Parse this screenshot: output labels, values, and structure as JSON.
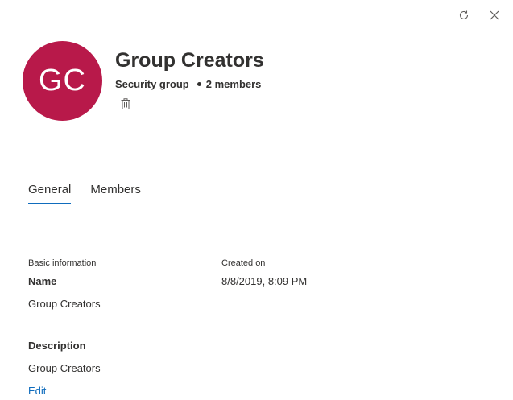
{
  "header": {
    "avatar_initials": "GC",
    "avatar_color": "#b8194a",
    "title": "Group Creators",
    "group_type": "Security group",
    "member_count": "2 members",
    "icons": [
      "refresh-icon",
      "close-icon",
      "trash-icon"
    ]
  },
  "tabs": [
    {
      "label": "General",
      "active": true
    },
    {
      "label": "Members",
      "active": false
    }
  ],
  "general": {
    "basic_info_heading": "Basic information",
    "name_label": "Name",
    "name_value": "Group Creators",
    "created_label": "Created on",
    "created_value": "8/8/2019, 8:09 PM",
    "description_label": "Description",
    "description_value": "Group Creators",
    "edit_label": "Edit"
  },
  "colors": {
    "accent": "#0f6cbd",
    "text": "#323130"
  }
}
